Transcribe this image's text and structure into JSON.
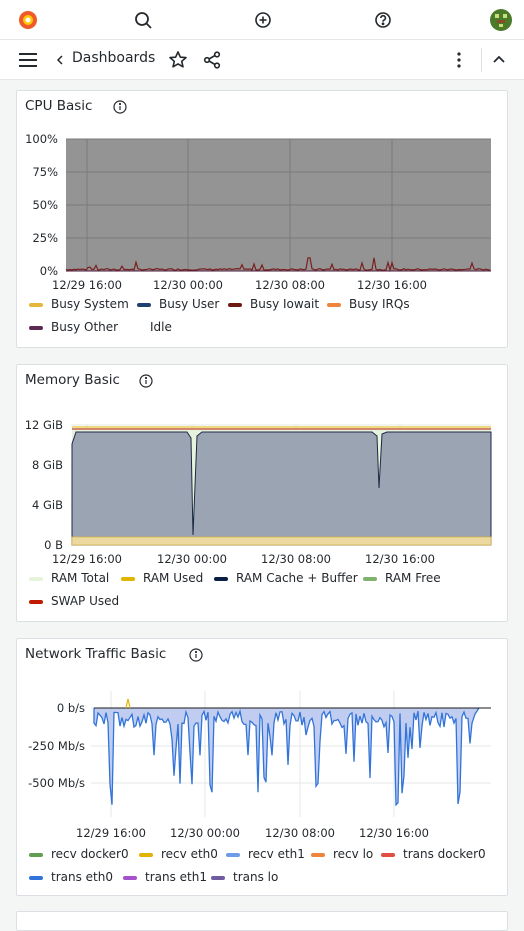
{
  "topbar": {
    "icons": [
      "grafana-logo-icon",
      "search-icon",
      "plus-circle-icon",
      "help-icon",
      "avatar"
    ]
  },
  "subbar": {
    "breadcrumb": "Dashboards",
    "icons": [
      "menu-icon",
      "chevron-left-icon",
      "star-icon",
      "share-icon",
      "kebab-icon",
      "chevron-up-icon"
    ]
  },
  "panels": {
    "cpu": {
      "title": "CPU Basic",
      "legend": [
        {
          "label": "Busy System",
          "color": "#e5b73b"
        },
        {
          "label": "Busy User",
          "color": "#1f3f6e"
        },
        {
          "label": "Busy Iowait",
          "color": "#6e1a12"
        },
        {
          "label": "Busy IRQs",
          "color": "#ef843c"
        },
        {
          "label": "Busy Other",
          "color": "#5b2a52"
        },
        {
          "label": "Idle",
          "color": ""
        }
      ]
    },
    "memory": {
      "title": "Memory Basic",
      "legend": [
        {
          "label": "RAM Total",
          "color": "#e6f4dc"
        },
        {
          "label": "RAM Used",
          "color": "#e0b400"
        },
        {
          "label": "RAM Cache + Buffer",
          "color": "#0a1f44"
        },
        {
          "label": "RAM Free",
          "color": "#7eb26d"
        },
        {
          "label": "SWAP Used",
          "color": "#bf1b00"
        }
      ]
    },
    "network": {
      "title": "Network Traffic Basic",
      "legend": [
        {
          "label": "recv docker0",
          "color": "#629e51"
        },
        {
          "label": "recv eth0",
          "color": "#e0b400"
        },
        {
          "label": "recv eth1",
          "color": "#6d9be8"
        },
        {
          "label": "recv lo",
          "color": "#ef843c"
        },
        {
          "label": "trans docker0",
          "color": "#e24d42"
        },
        {
          "label": "trans eth0",
          "color": "#3274d9"
        },
        {
          "label": "trans eth1",
          "color": "#a352cc"
        },
        {
          "label": "trans lo",
          "color": "#705da0"
        }
      ]
    }
  },
  "chart_data": [
    {
      "type": "area",
      "title": "CPU Basic",
      "yticks": [
        "100%",
        "75%",
        "50%",
        "25%",
        "0%"
      ],
      "xticks": [
        "12/29 16:00",
        "12/30 00:00",
        "12/30 08:00",
        "12/30 16:00"
      ],
      "ylim": [
        0,
        100
      ],
      "series": [
        {
          "name": "Idle",
          "approx_value": 98
        },
        {
          "name": "Busy Iowait",
          "approx_value": 1
        }
      ]
    },
    {
      "type": "area",
      "title": "Memory Basic",
      "yticks": [
        "12 GiB",
        "8 GiB",
        "4 GiB",
        "0 B"
      ],
      "xticks": [
        "12/29 16:00",
        "12/30 00:00",
        "12/30 08:00",
        "12/30 16:00"
      ],
      "ylim": [
        0,
        12
      ],
      "series": [
        {
          "name": "RAM Total",
          "approx_value": 12
        },
        {
          "name": "RAM Cache + Buffer",
          "approx_value": 11.3
        },
        {
          "name": "RAM Used",
          "approx_value": 1
        }
      ]
    },
    {
      "type": "area",
      "title": "Network Traffic Basic",
      "yticks": [
        "0 b/s",
        "-250 Mb/s",
        "-500 Mb/s"
      ],
      "xticks": [
        "12/29 16:00",
        "12/30 00:00",
        "12/30 08:00",
        "12/30 16:00"
      ],
      "series": [
        {
          "name": "trans eth0",
          "approx_min": -650
        }
      ]
    }
  ]
}
